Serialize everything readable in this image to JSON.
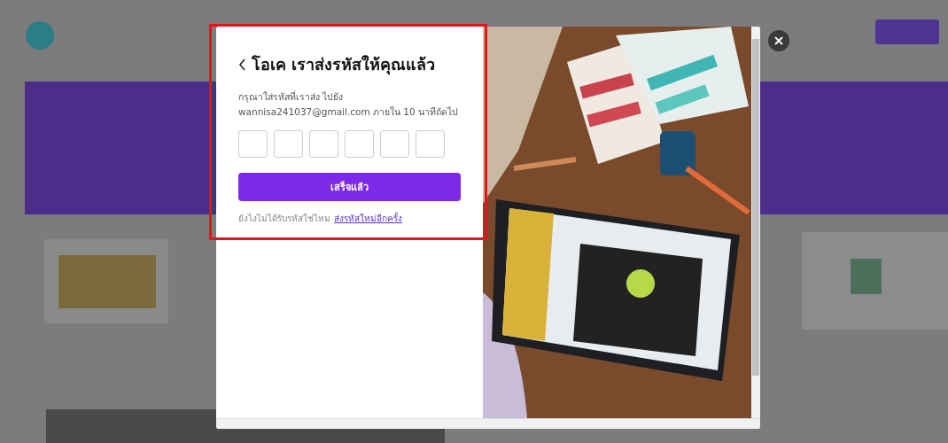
{
  "dialog": {
    "title": "โอเค เราส่งรหัสให้คุณแล้ว",
    "instruction": "กรุณาใส่รหัสที่เราส่ง ไปยัง\nwannisa241037@gmail.com ภายใน 10 นาทีถัดไป",
    "code_boxes": [
      {
        "kind": "digit"
      },
      {
        "kind": "digit"
      },
      {
        "kind": "digit"
      },
      {
        "kind": "digit"
      },
      {
        "kind": "digit"
      },
      {
        "kind": "digit"
      }
    ],
    "submit_button": "เสร็จแล้ว",
    "resend_prompt": "ยังไงไม่ได้รับรหัสใช่ไหม",
    "resend_link": "ส่งรหัสใหม่อีกครั้ง"
  }
}
